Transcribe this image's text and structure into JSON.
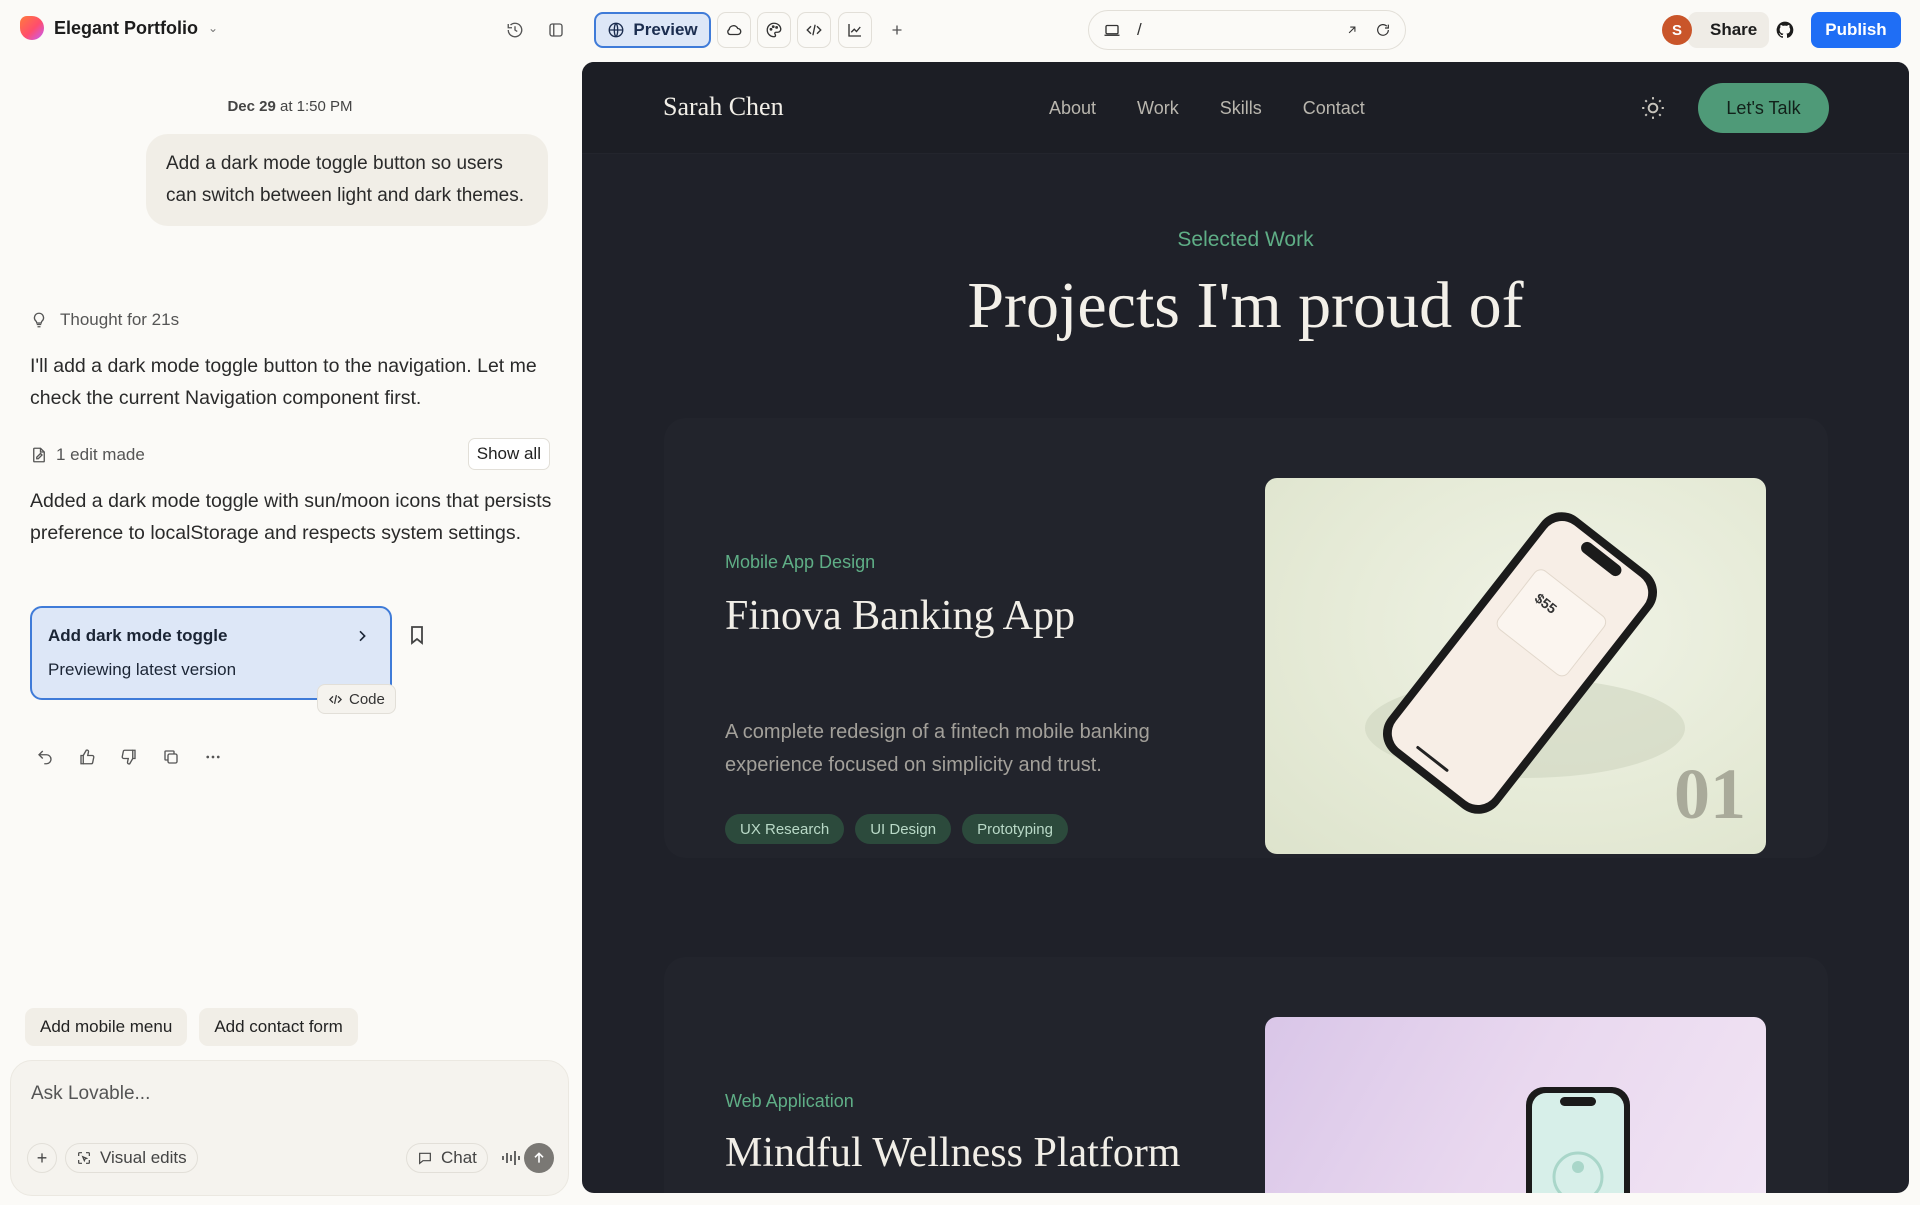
{
  "project": {
    "name": "Elegant Portfolio"
  },
  "toolbar": {
    "preview_label": "Preview",
    "url_path": "/",
    "avatar_initial": "S",
    "share_label": "Share",
    "publish_label": "Publish",
    "accent_color": "#1f6ef5"
  },
  "chat": {
    "timestamp_date": "Dec 29",
    "timestamp_time": "at 1:50 PM",
    "user_message": "Add a dark mode toggle button so users can switch between light and dark themes.",
    "thought": "Thought for 21s",
    "ai_message_1": "I'll add a dark mode toggle button to the navigation. Let me check the current Navigation component first.",
    "edits_label": "1 edit made",
    "show_all_label": "Show all",
    "ai_message_2": "Added a dark mode toggle with sun/moon icons that persists preference to localStorage and respects system settings.",
    "version": {
      "title": "Add dark mode toggle",
      "subtitle": "Previewing latest version"
    },
    "code_label": "Code",
    "suggestions": [
      "Add mobile menu",
      "Add contact form"
    ],
    "composer": {
      "placeholder": "Ask Lovable...",
      "visual_edits_label": "Visual edits",
      "chat_label": "Chat"
    }
  },
  "site": {
    "brand": "Sarah Chen",
    "nav": [
      "About",
      "Work",
      "Skills",
      "Contact"
    ],
    "cta_label": "Let's Talk",
    "section_label": "Selected Work",
    "section_title": "Projects I'm proud of",
    "projects": [
      {
        "category": "Mobile App Design",
        "title": "Finova Banking App",
        "description": "A complete redesign of a fintech mobile banking experience focused on simplicity and trust.",
        "tags": [
          "UX Research",
          "UI Design",
          "Prototyping"
        ],
        "number": "01",
        "card_text": "$55"
      },
      {
        "category": "Web Application",
        "title": "Mindful Wellness Platform"
      }
    ],
    "accent_green": "#5fae86"
  }
}
